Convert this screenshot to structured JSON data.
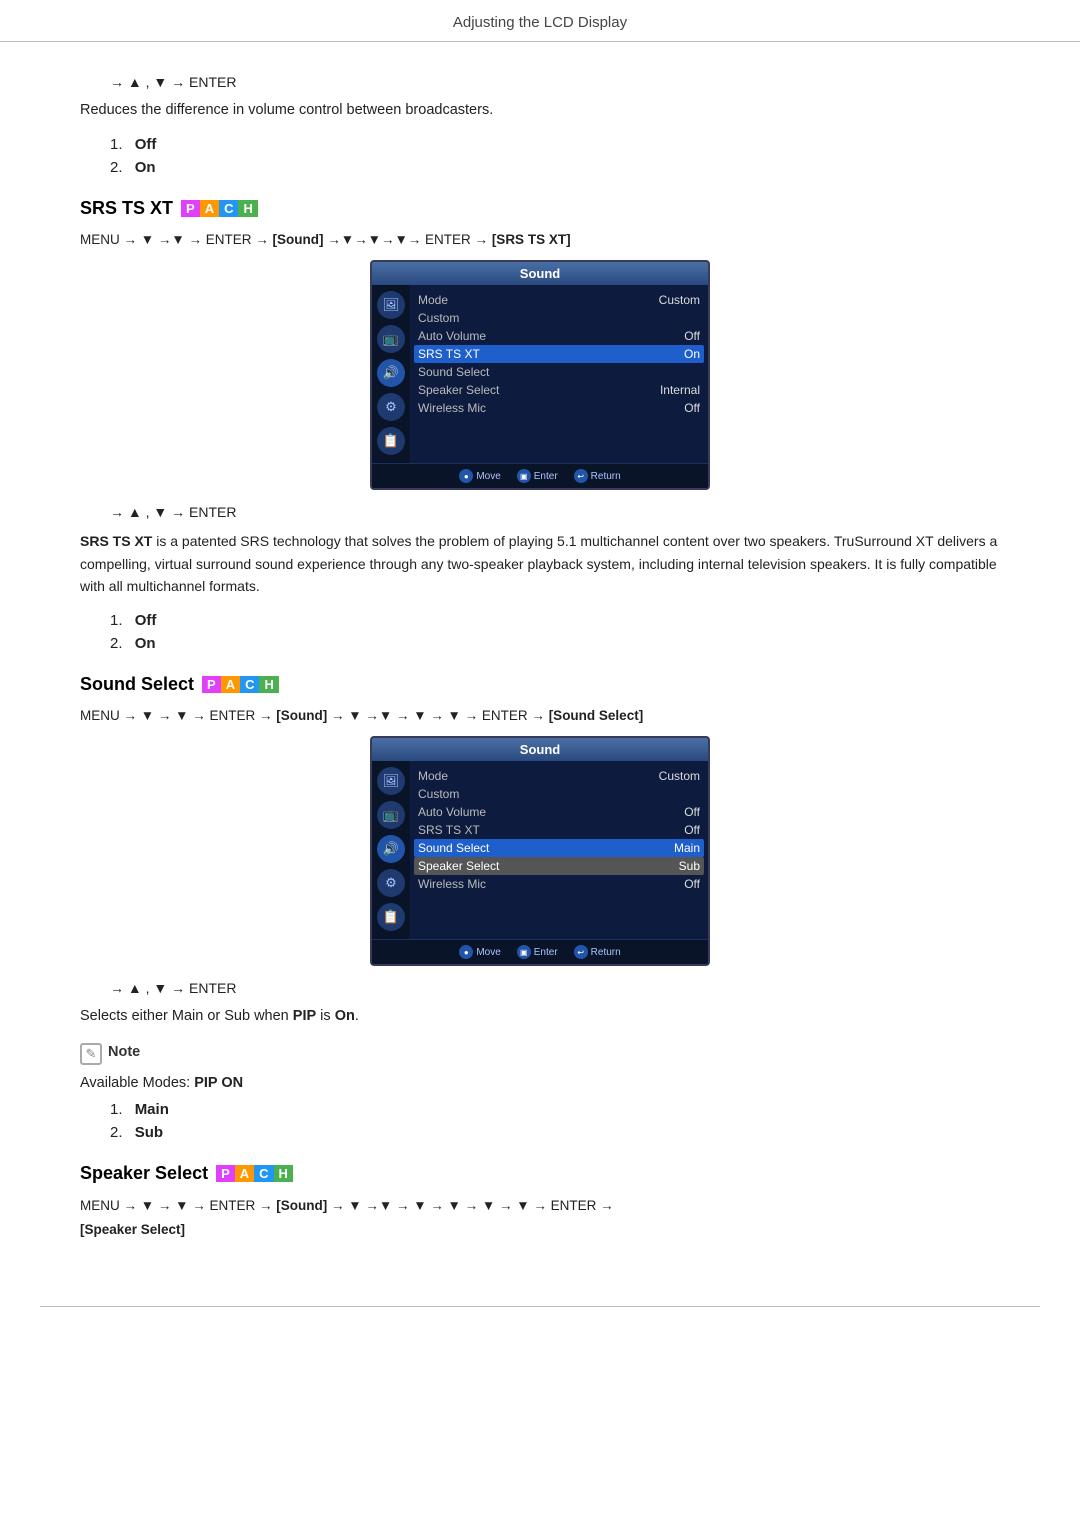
{
  "page": {
    "header": "Adjusting the LCD Display"
  },
  "sections": {
    "intro_nav": "→ ▲ , ▼ → ENTER",
    "intro_desc": "Reduces the difference in volume control between broadcasters.",
    "intro_items": [
      {
        "num": "1.",
        "label": "Off"
      },
      {
        "num": "2.",
        "label": "On"
      }
    ],
    "srs_ts_xt": {
      "heading": "SRS TS XT",
      "badge": [
        "P",
        "A",
        "C",
        "H"
      ],
      "menu_formula": "MENU → ▼ →▼ → ENTER → [Sound] →▼→▼→▼→ ENTER → [SRS TS XT]",
      "tv_menu": {
        "title": "Sound",
        "rows": [
          {
            "label": "Mode",
            "value": "Custom",
            "highlight": false
          },
          {
            "label": "Custom",
            "value": "",
            "highlight": false
          },
          {
            "label": "Auto Volume",
            "value": "Off",
            "highlight": false
          },
          {
            "label": "SRS TS XT",
            "value": "On",
            "highlight": true
          },
          {
            "label": "Sound Select",
            "value": "",
            "highlight": false
          },
          {
            "label": "Speaker Select",
            "value": "Internal",
            "highlight": false
          },
          {
            "label": "Wireless Mic",
            "value": "Off",
            "highlight": false
          }
        ],
        "footer": [
          {
            "icon": "●",
            "label": "Move"
          },
          {
            "icon": "▣",
            "label": "Enter"
          },
          {
            "icon": "↩",
            "label": "Return"
          }
        ]
      },
      "nav2": "→ ▲ , ▼ → ENTER",
      "long_desc_parts": {
        "bold_part": "SRS TS XT",
        "rest": " is a patented SRS technology that solves the problem of playing 5.1 multichannel content over two speakers. TruSurround XT delivers a compelling, virtual surround sound experience through any two-speaker playback system, including internal television speakers. It is fully compatible with all multichannel formats."
      },
      "items": [
        {
          "num": "1.",
          "label": "Off"
        },
        {
          "num": "2.",
          "label": "On"
        }
      ]
    },
    "sound_select": {
      "heading": "Sound Select",
      "badge": [
        "P",
        "A",
        "C",
        "H"
      ],
      "menu_formula": "MENU → ▼ → ▼ → ENTER → [Sound] → ▼ →▼ → ▼ → ▼ → ENTER → [Sound Select]",
      "tv_menu": {
        "title": "Sound",
        "rows": [
          {
            "label": "Mode",
            "value": "Custom",
            "highlight": false
          },
          {
            "label": "Custom",
            "value": "",
            "highlight": false
          },
          {
            "label": "Auto Volume",
            "value": "Off",
            "highlight": false
          },
          {
            "label": "SRS TS XT",
            "value": "Off",
            "highlight": false
          },
          {
            "label": "Sound Select",
            "value": "Main",
            "highlight": true
          },
          {
            "label": "Speaker Select",
            "value": "Sub",
            "highlight": "sub"
          },
          {
            "label": "Wireless Mic",
            "value": "Off",
            "highlight": false
          }
        ],
        "footer": [
          {
            "icon": "●",
            "label": "Move"
          },
          {
            "icon": "▣",
            "label": "Enter"
          },
          {
            "icon": "↩",
            "label": "Return"
          }
        ]
      },
      "nav2": "→ ▲ , ▼ → ENTER",
      "desc_prefix": "Selects either Main or Sub when ",
      "desc_bold": "PIP",
      "desc_suffix": " is ",
      "desc_on": "On",
      "desc_period": ".",
      "note_label": "Note",
      "available_modes_prefix": "Available Modes: ",
      "available_modes_bold": "PIP ON",
      "items": [
        {
          "num": "1.",
          "label": "Main"
        },
        {
          "num": "2.",
          "label": "Sub"
        }
      ]
    },
    "speaker_select": {
      "heading": "Speaker Select",
      "badge": [
        "P",
        "A",
        "C",
        "H"
      ],
      "menu_formula_line1": "MENU → ▼ → ▼ → ENTER → [Sound] → ▼ →▼ → ▼ → ▼ → ▼ → ▼ → ENTER →",
      "menu_formula_line2": "[Speaker Select]"
    }
  }
}
